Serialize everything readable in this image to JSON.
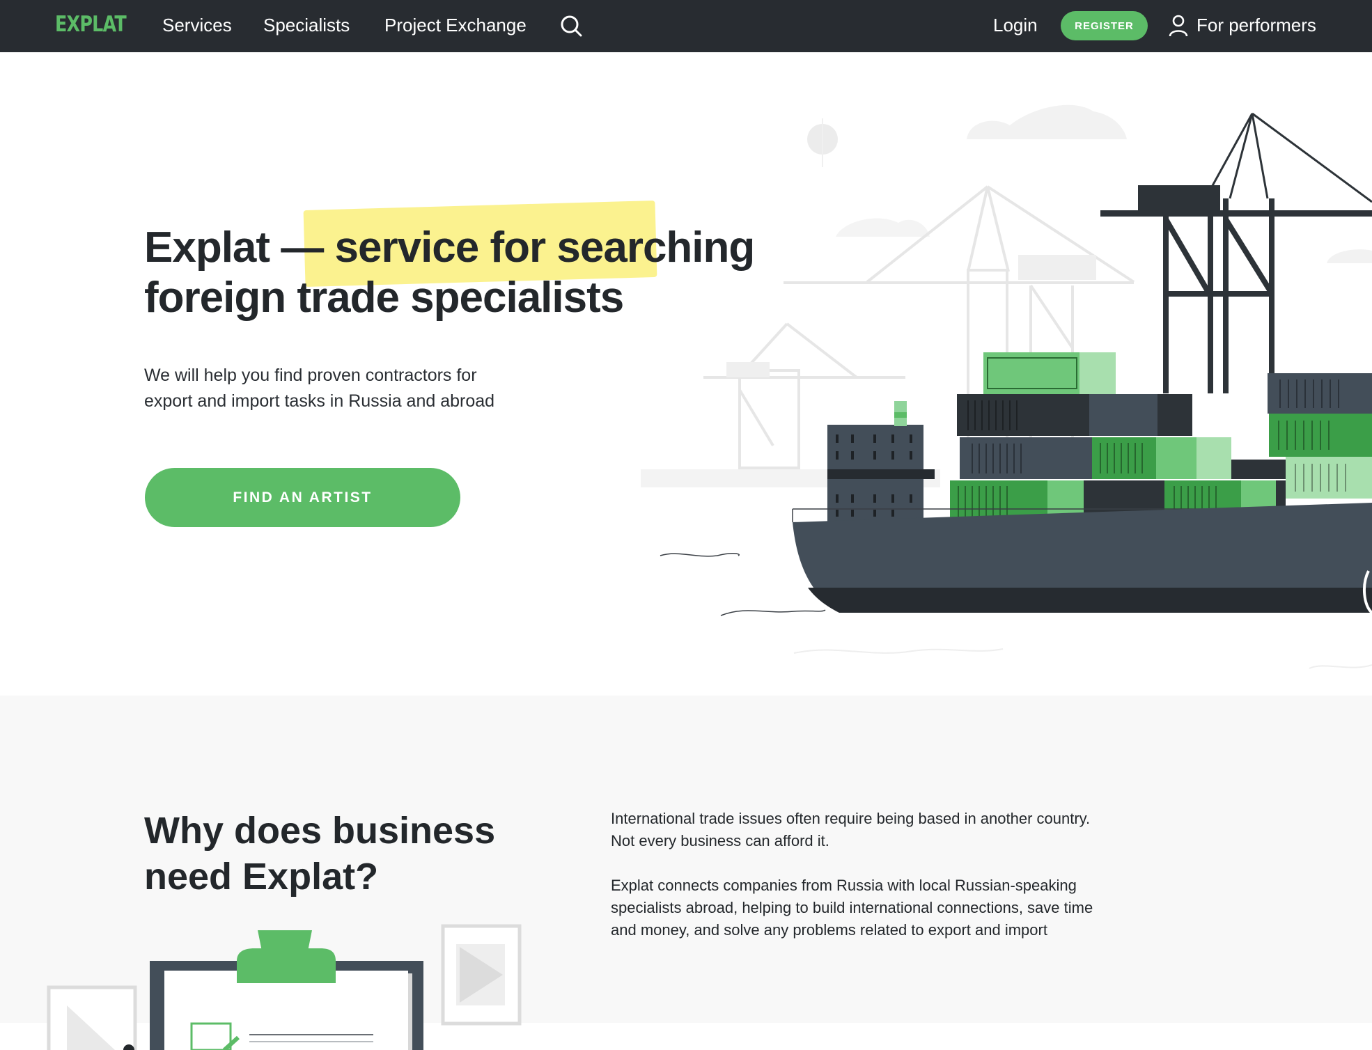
{
  "brand": {
    "logo": "EXPLAT",
    "accent": "#5cbc67",
    "dark": "#282c31",
    "highlight": "#fbf28f"
  },
  "nav": {
    "links": [
      "Services",
      "Specialists",
      "Project Exchange"
    ],
    "search_icon": "search-icon",
    "login": "Login",
    "register": "REGISTER",
    "user_icon": "user-icon",
    "for_performers": "For performers"
  },
  "hero": {
    "title_line1": "Explat — service for searching",
    "title_line2": "foreign trade specialists",
    "subtitle_line1": "We will help you find proven contractors for",
    "subtitle_line2": "export and import tasks in Russia and abroad",
    "cta": "FIND AN ARTIST"
  },
  "why": {
    "title": "Why does business need Explat?",
    "p1_line1": "International trade issues often require being based in another country.",
    "p1_line2": "Not every business can afford it.",
    "p2_line1": "Explat connects companies from Russia with local Russian-speaking",
    "p2_line2": "specialists abroad, helping to build international connections, save time",
    "p2_line3": "and money, and solve any problems related to export and import"
  }
}
